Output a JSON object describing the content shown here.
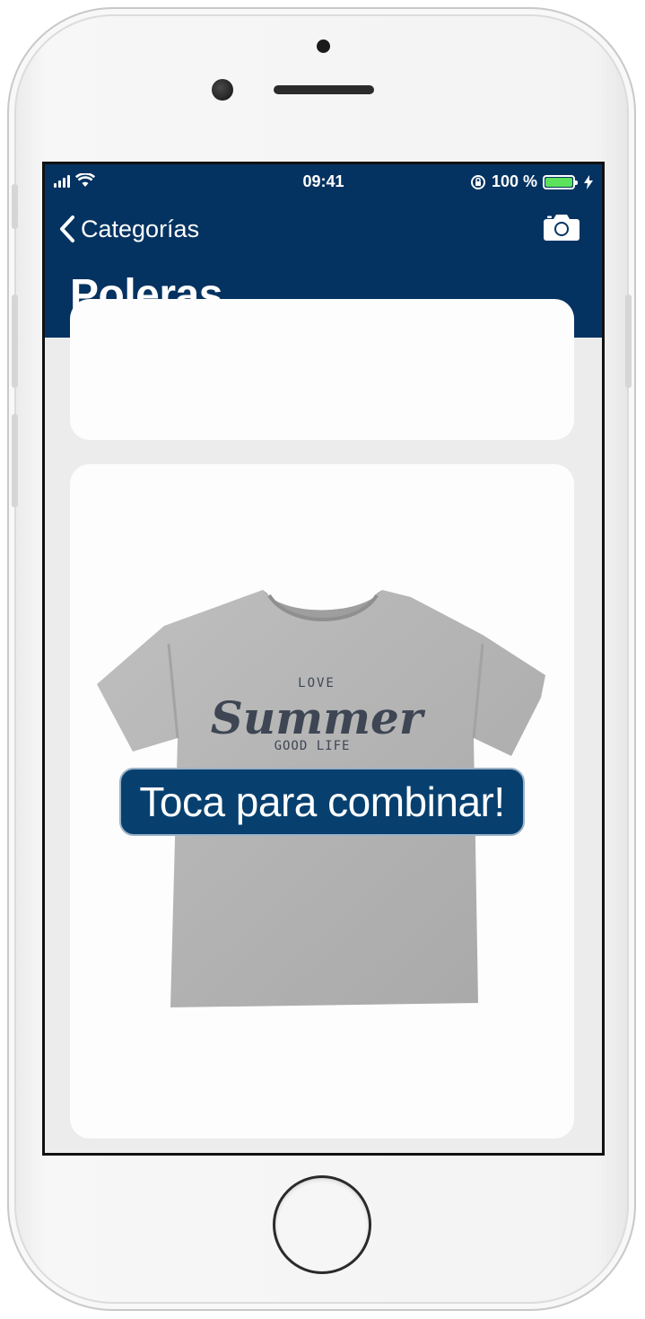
{
  "status_bar": {
    "time": "09:41",
    "battery_percent": "100 %",
    "battery_level": 1.0,
    "icons": [
      "signal-icon",
      "wifi-icon",
      "orientation-lock-icon",
      "battery-icon",
      "charging-icon"
    ]
  },
  "nav": {
    "back_label": "Categorías",
    "title": "Poleras",
    "camera_icon": "camera-icon"
  },
  "product": {
    "shirt_text_top": "LOVE",
    "shirt_text_main": "Summer",
    "shirt_text_bottom": "GOOD LIFE",
    "cta_label": "Toca para combinar!"
  },
  "colors": {
    "nav_bg": "#043361",
    "cta_bg": "#07406f",
    "battery_fill": "#5ce25b"
  }
}
